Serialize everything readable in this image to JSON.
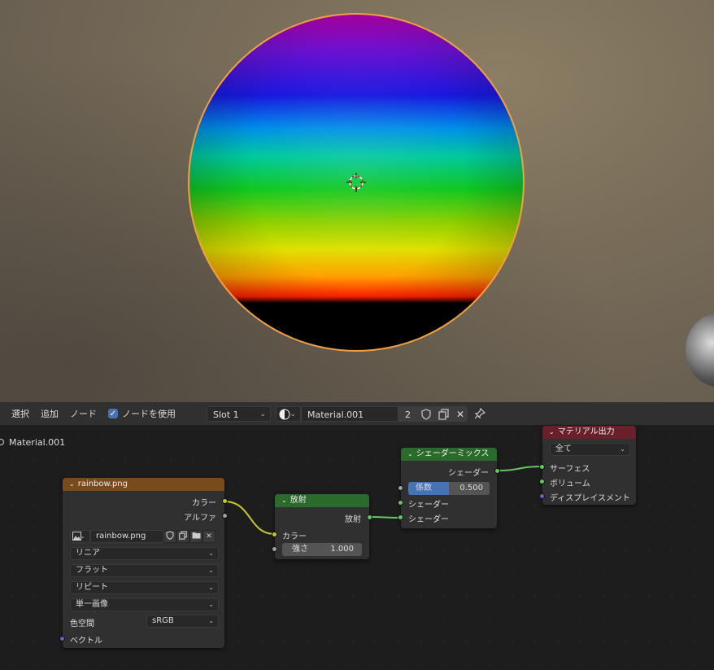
{
  "header": {
    "menu_select": "選択",
    "menu_add": "追加",
    "menu_node": "ノード",
    "use_nodes_label": "ノードを使用",
    "use_nodes_checked": true,
    "slot_value": "Slot 1",
    "material_name": "Material.001",
    "user_count": "2",
    "icons": [
      "shader-ball-icon",
      "fake-user-shield-icon",
      "duplicate-icon",
      "close-icon",
      "pin-icon"
    ]
  },
  "editor": {
    "breadcrumb": "Material.001"
  },
  "image_node": {
    "title": "rainbow.png",
    "out_color": "カラー",
    "out_alpha": "アルファ",
    "image_name": "rainbow.png",
    "interpolation": "リニア",
    "projection": "フラット",
    "extension": "リピート",
    "source": "単一画像",
    "colorspace_label": "色空間",
    "colorspace_value": "sRGB",
    "in_vector": "ベクトル",
    "header_color": "#7a4a1a"
  },
  "emission_node": {
    "title": "放射",
    "out_emission": "放射",
    "in_color": "カラー",
    "strength_label": "強さ",
    "strength_value": "1.000",
    "header_color": "#2a6a2a"
  },
  "mix_node": {
    "title": "シェーダーミックス",
    "out_shader": "シェーダー",
    "factor_label": "係数",
    "factor_value": "0.500",
    "factor_fraction": 0.5,
    "in_shader_1": "シェーダー",
    "in_shader_2": "シェーダー",
    "header_color": "#2a6a2a"
  },
  "output_node": {
    "title": "マテリアル出力",
    "target": "全て",
    "in_surface": "サーフェス",
    "in_volume": "ボリューム",
    "in_displacement": "ディスプレイスメント",
    "header_color": "#6a1f2a"
  }
}
